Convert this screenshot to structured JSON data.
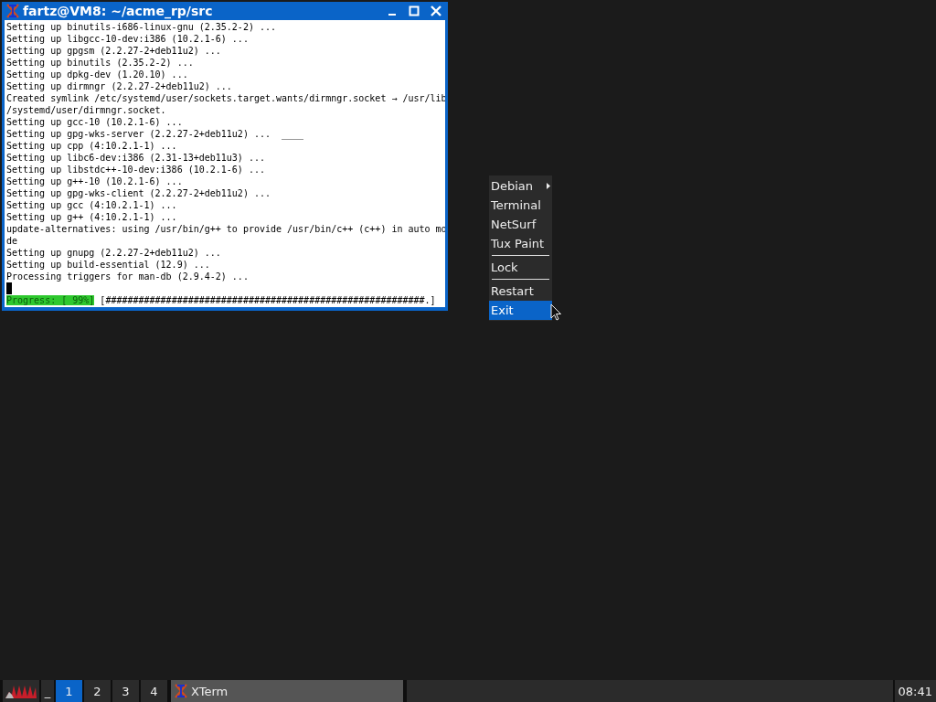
{
  "window": {
    "title": "fartz@VM8: ~/acme_rp/src"
  },
  "terminal": {
    "lines": [
      "Setting up binutils-i686-linux-gnu (2.35.2-2) ...",
      "Setting up libgcc-10-dev:i386 (10.2.1-6) ...",
      "Setting up gpgsm (2.2.27-2+deb11u2) ...",
      "Setting up binutils (2.35.2-2) ...",
      "Setting up dpkg-dev (1.20.10) ...",
      "Setting up dirmngr (2.2.27-2+deb11u2) ...",
      "Created symlink /etc/systemd/user/sockets.target.wants/dirmngr.socket → /usr/lib",
      "/systemd/user/dirmngr.socket.",
      "Setting up gcc-10 (10.2.1-6) ...",
      "Setting up gpg-wks-server (2.2.27-2+deb11u2) ...  ____",
      "Setting up cpp (4:10.2.1-1) ...",
      "Setting up libc6-dev:i386 (2.31-13+deb11u3) ...",
      "Setting up libstdc++-10-dev:i386 (10.2.1-6) ...",
      "Setting up g++-10 (10.2.1-6) ...",
      "Setting up gpg-wks-client (2.2.27-2+deb11u2) ...",
      "Setting up gcc (4:10.2.1-1) ...",
      "Setting up g++ (4:10.2.1-1) ...",
      "update-alternatives: using /usr/bin/g++ to provide /usr/bin/c++ (c++) in auto mo",
      "de",
      "Setting up gnupg (2.2.27-2+deb11u2) ...",
      "Setting up build-essential (12.9) ...",
      "Processing triggers for man-db (2.9.4-2) ..."
    ],
    "cursor": true,
    "progress": {
      "label": "Progress: [ 99%]",
      "bar": "[##########################################################.]"
    }
  },
  "menu": [
    {
      "kind": "item",
      "label": "Debian",
      "submenu": true,
      "selected": false
    },
    {
      "kind": "item",
      "label": "Terminal",
      "submenu": false,
      "selected": false
    },
    {
      "kind": "item",
      "label": "NetSurf",
      "submenu": false,
      "selected": false
    },
    {
      "kind": "item",
      "label": "Tux Paint",
      "submenu": false,
      "selected": false
    },
    {
      "kind": "separator"
    },
    {
      "kind": "item",
      "label": "Lock",
      "submenu": false,
      "selected": false
    },
    {
      "kind": "separator"
    },
    {
      "kind": "item",
      "label": "Restart",
      "submenu": false,
      "selected": false
    },
    {
      "kind": "item",
      "label": "Exit",
      "submenu": false,
      "selected": true
    }
  ],
  "taskbar": {
    "minimize": "_",
    "desktops": [
      {
        "label": "1",
        "selected": true
      },
      {
        "label": "2",
        "selected": false
      },
      {
        "label": "3",
        "selected": false
      },
      {
        "label": "4",
        "selected": false
      }
    ],
    "tasks": [
      {
        "label": "XTerm"
      }
    ],
    "clock": "08:41"
  }
}
